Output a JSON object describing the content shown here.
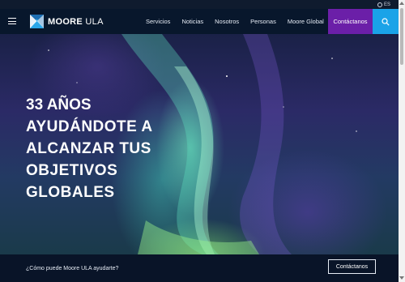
{
  "topbar": {
    "language": "ES",
    "globe_icon": "globe-icon"
  },
  "navbar": {
    "logo_bold": "MOORE",
    "logo_rest": "ULA",
    "links": [
      "Servicios",
      "Noticias",
      "Nosotros",
      "Personas",
      "Moore Global"
    ],
    "cta_label": "Contáctanos",
    "icons": {
      "menu": "hamburger-icon",
      "search": "search-icon"
    },
    "colors": {
      "bar": "#08172c",
      "cta": "#6b1fa8",
      "search": "#1aa3e8"
    }
  },
  "hero": {
    "title_line1": "33 AÑOS",
    "title_line2": "AYUDÁNDOTE A",
    "title_line3": "ALCANZAR TUS",
    "title_line4": "OBJETIVOS",
    "title_line5": "GLOBALES"
  },
  "cta_bar": {
    "question": "¿Cómo puede Moore ULA ayudarte?",
    "button_label": "Contáctanos"
  }
}
